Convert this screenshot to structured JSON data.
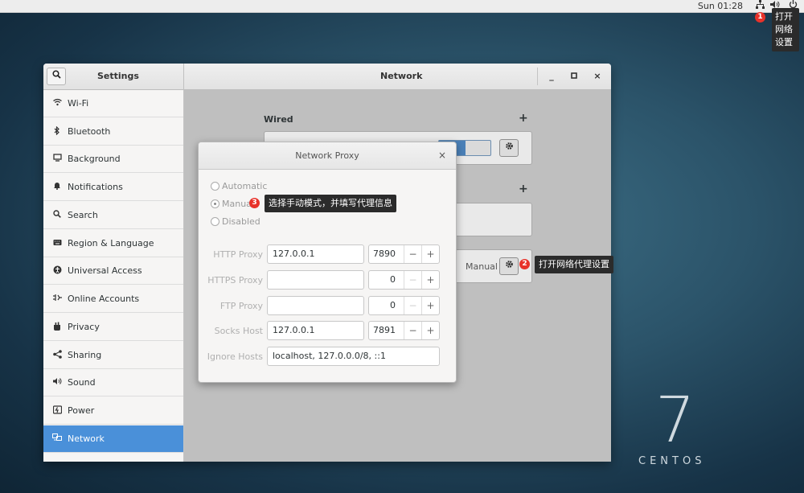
{
  "topbar": {
    "clock": "Sun 01:28",
    "icons": [
      "network-icon",
      "volume-icon",
      "power-icon"
    ],
    "network_tooltip": [
      "打开",
      "网络",
      "设置"
    ]
  },
  "branding": {
    "number": "7",
    "name": "CENTOS"
  },
  "settings_window": {
    "sidebar_title": "Settings",
    "panel_title": "Network",
    "controls": {
      "minimize": "_",
      "maximize": "□",
      "close": "×"
    },
    "sidebar_items": [
      {
        "label": "Wi-Fi",
        "icon": "wifi-icon"
      },
      {
        "label": "Bluetooth",
        "icon": "bluetooth-icon"
      },
      {
        "label": "Background",
        "icon": "background-icon"
      },
      {
        "label": "Notifications",
        "icon": "bell-icon"
      },
      {
        "label": "Search",
        "icon": "search-icon"
      },
      {
        "label": "Region & Language",
        "icon": "keyboard-icon"
      },
      {
        "label": "Universal Access",
        "icon": "accessibility-icon"
      },
      {
        "label": "Online Accounts",
        "icon": "online-accounts-icon"
      },
      {
        "label": "Privacy",
        "icon": "hand-icon"
      },
      {
        "label": "Sharing",
        "icon": "share-icon"
      },
      {
        "label": "Sound",
        "icon": "sound-icon"
      },
      {
        "label": "Power",
        "icon": "power-icon"
      },
      {
        "label": "Network",
        "icon": "network-icon",
        "active": true
      }
    ],
    "content": {
      "wired_label": "Wired",
      "add_symbol": "+",
      "proxy_mode": "Manual"
    }
  },
  "proxy_dialog": {
    "title": "Network Proxy",
    "close": "×",
    "modes": [
      "Automatic",
      "Manual",
      "Disabled"
    ],
    "selected_mode": "Manual",
    "fields": [
      {
        "label": "HTTP Proxy",
        "host": "127.0.0.1",
        "port": "7890"
      },
      {
        "label": "HTTPS Proxy",
        "host": "",
        "port": "0"
      },
      {
        "label": "FTP Proxy",
        "host": "",
        "port": "0"
      },
      {
        "label": "Socks Host",
        "host": "127.0.0.1",
        "port": "7891"
      }
    ],
    "ignore_label": "Ignore Hosts",
    "ignore_value": "localhost, 127.0.0.0/8, ::1",
    "spin_minus": "−",
    "spin_plus": "+"
  },
  "annotations": {
    "step1": "1",
    "step2": "2",
    "step2_text": "打开网络代理设置",
    "step3": "3",
    "step3_text": "选择手动模式，并填写代理信息"
  },
  "colors": {
    "accent": "#4a90d9",
    "badge": "#e8322a",
    "tooltip": "#2b2b2b"
  }
}
